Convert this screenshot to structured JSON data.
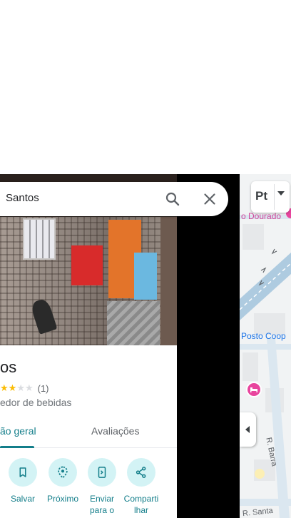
{
  "search": {
    "value": "Santos"
  },
  "place": {
    "title": "os",
    "rating_count": "(1)",
    "category": "edor de bebidas",
    "rating": 3,
    "rating_max": 5
  },
  "tabs": [
    {
      "label": "ão geral",
      "active": true
    },
    {
      "label": "Avaliações",
      "active": false
    }
  ],
  "actions": [
    {
      "label": "Salvar",
      "icon": "bookmark-icon"
    },
    {
      "label": "Próximo",
      "icon": "nearby-icon"
    },
    {
      "label": "Enviar para o",
      "icon": "send-to-phone-icon"
    },
    {
      "label": "Comparti lhar",
      "icon": "share-icon"
    }
  ],
  "map": {
    "layer_label": "Pt",
    "labels": {
      "posto_dourado": "o Dourado",
      "posto_coop": "Posto Coop",
      "street_barra": "R. Barra",
      "street_santa": "R. Santa"
    }
  },
  "colors": {
    "accent": "#137e8a",
    "accent_light": "#d3f3f5",
    "star": "#fbbc04",
    "poi_pink": "#e8459e",
    "road": "#aecbe0"
  }
}
